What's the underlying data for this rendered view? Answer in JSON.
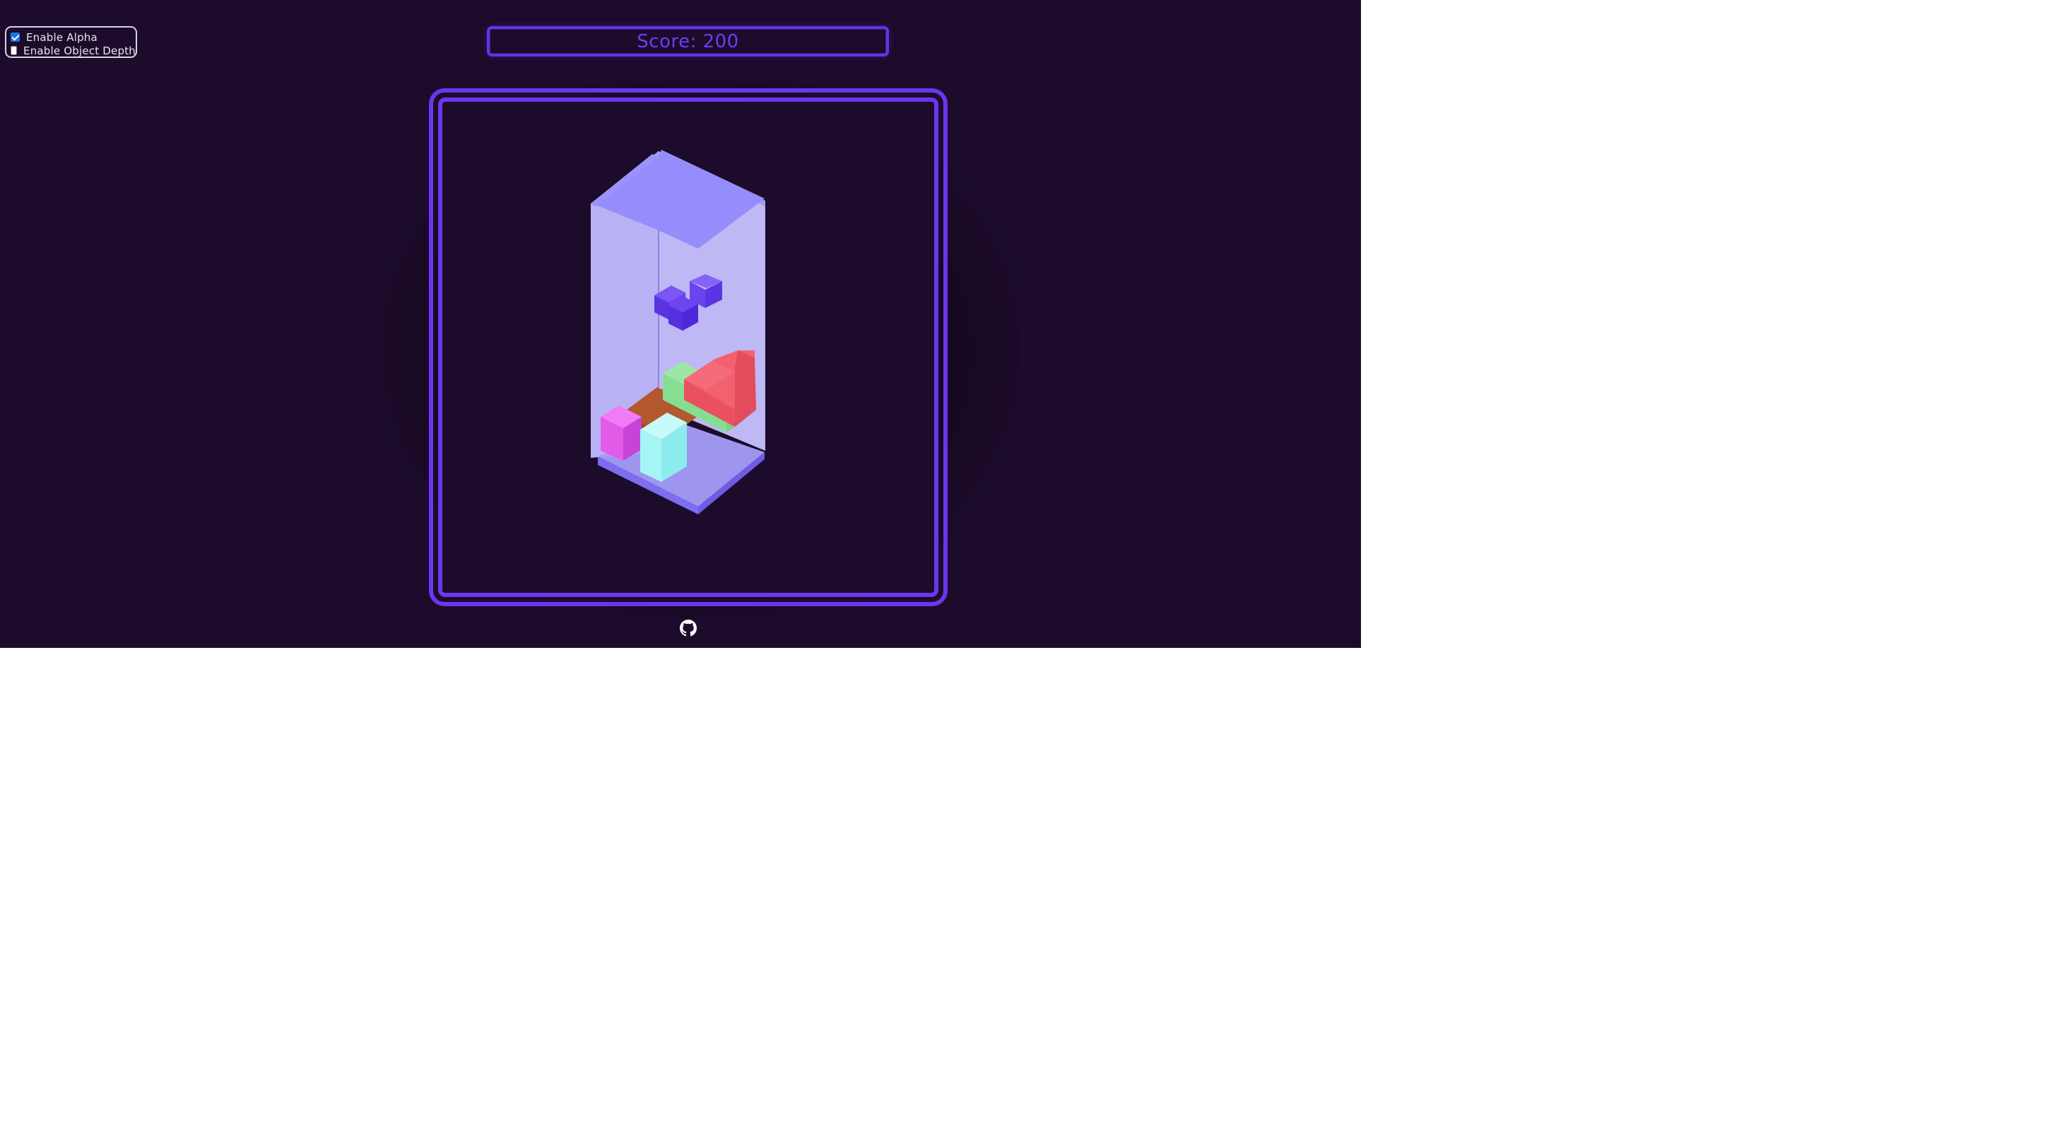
{
  "settings": {
    "options": [
      {
        "label": "Enable Alpha",
        "checked": true
      },
      {
        "label": "Enable Object Depth",
        "checked": false
      }
    ]
  },
  "score": {
    "text": "Score: 200",
    "value": 200
  },
  "colors": {
    "background": "#1c0b2b",
    "accent": "#6a36ef",
    "well_glass": "#b8b2ff",
    "piece_falling": "#5b35e6",
    "piece_red": "#f0566a",
    "piece_green": "#8fe39a",
    "piece_orange": "#b8582c",
    "piece_magenta": "#e05ae8",
    "piece_cyan": "#9ff3f3"
  },
  "footer": {
    "icon": "github-icon"
  }
}
